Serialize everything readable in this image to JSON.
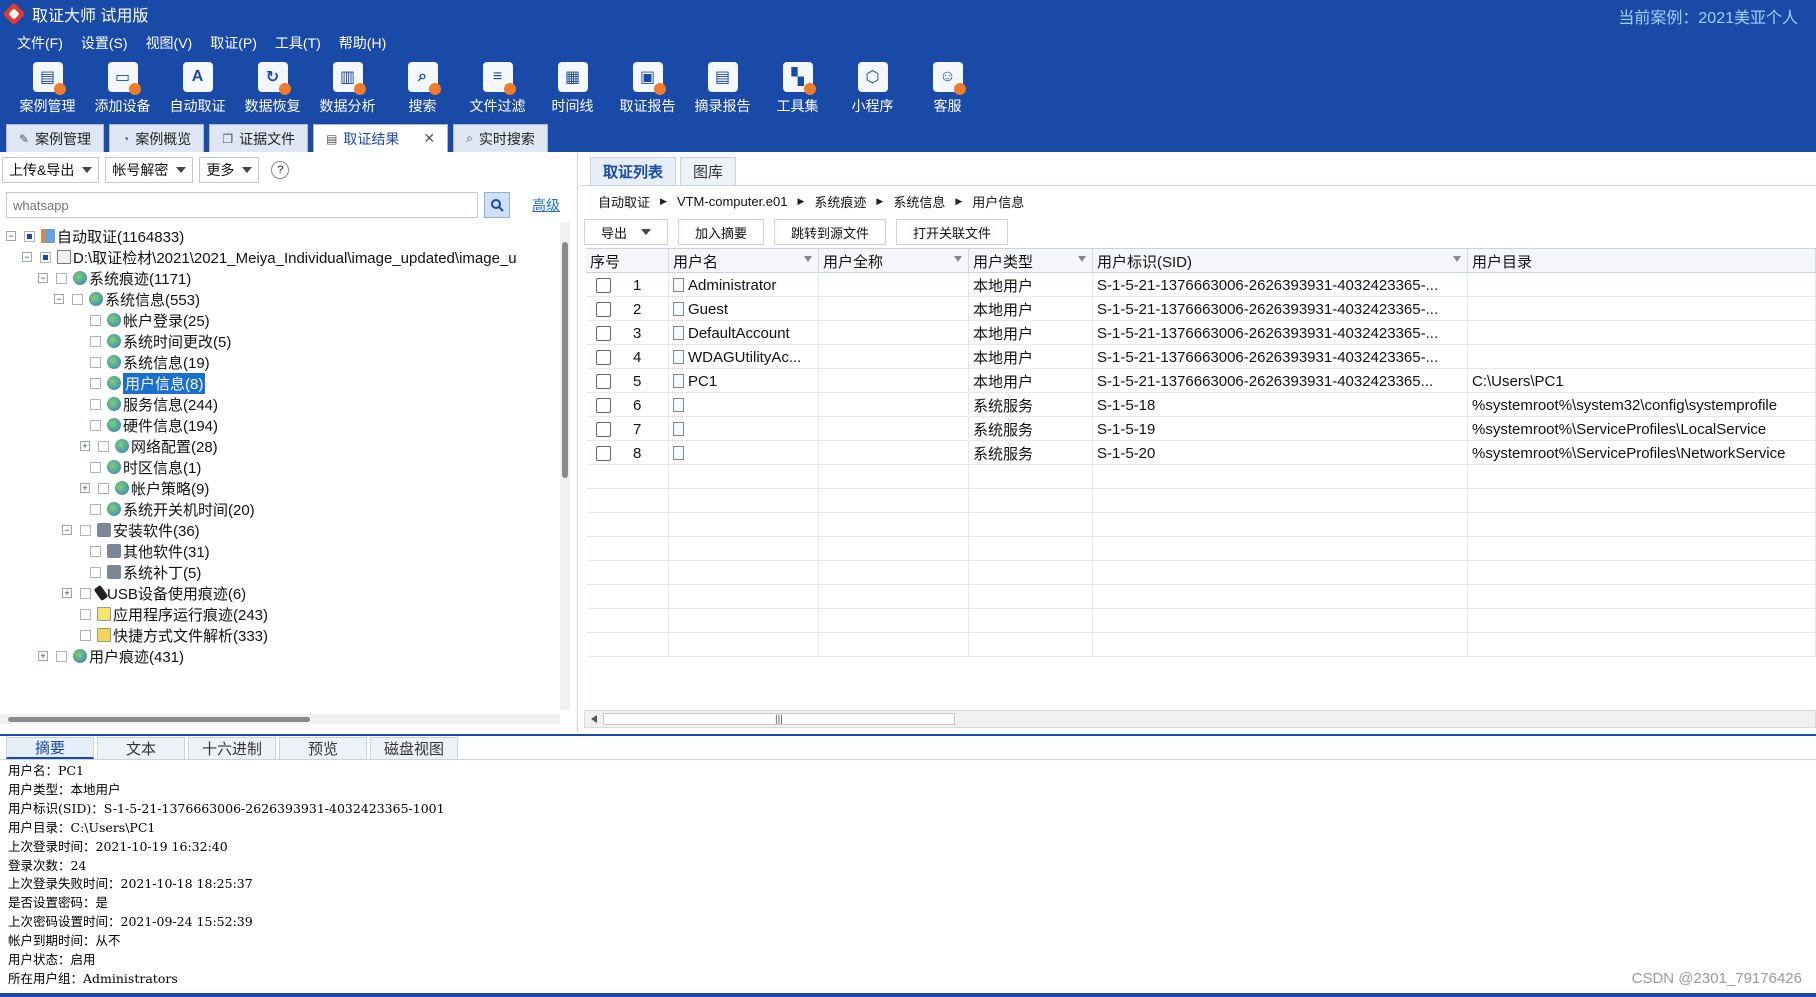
{
  "titlebar": {
    "app_title": "取证大师 试用版",
    "case_label": "当前案例：2021美亚个人"
  },
  "menu": [
    "文件(F)",
    "设置(S)",
    "视图(V)",
    "取证(P)",
    "工具(T)",
    "帮助(H)"
  ],
  "toolbar": [
    {
      "label": "案例管理",
      "icon": "case-icon"
    },
    {
      "label": "添加设备",
      "icon": "add-device-icon"
    },
    {
      "label": "自动取证",
      "icon": "auto-icon"
    },
    {
      "label": "数据恢复",
      "icon": "recover-icon"
    },
    {
      "label": "数据分析",
      "icon": "analysis-icon"
    },
    {
      "label": "搜索",
      "icon": "search-icon"
    },
    {
      "label": "文件过滤",
      "icon": "filter-icon"
    },
    {
      "label": "时间线",
      "icon": "timeline-icon"
    },
    {
      "label": "取证报告",
      "icon": "report-icon"
    },
    {
      "label": "摘录报告",
      "icon": "excerpt-icon"
    },
    {
      "label": "工具集",
      "icon": "tools-icon"
    },
    {
      "label": "小程序",
      "icon": "miniapp-icon"
    },
    {
      "label": "客服",
      "icon": "support-icon"
    }
  ],
  "top_tabs": [
    "案例管理",
    "案例概览",
    "证据文件",
    "取证结果",
    "实时搜索"
  ],
  "close_glyph": "✕",
  "left": {
    "upload_export": "上传&导出",
    "account_decrypt": "帐号解密",
    "more": "更多",
    "help": "?",
    "search_placeholder": "whatsapp",
    "advanced": "高级",
    "tree": [
      {
        "label": "自动取证(1164833)"
      },
      {
        "label": "D:\\取证检材\\2021\\2021_Meiya_Individual\\image_updated\\image_u"
      },
      {
        "label": "系统痕迹(1171)"
      },
      {
        "label": "系统信息(553)"
      },
      {
        "label": "帐户登录(25)"
      },
      {
        "label": "系统时间更改(5)"
      },
      {
        "label": "系统信息(19)"
      },
      {
        "label": "用户信息(8)"
      },
      {
        "label": "服务信息(244)"
      },
      {
        "label": "硬件信息(194)"
      },
      {
        "label": "网络配置(28)"
      },
      {
        "label": "时区信息(1)"
      },
      {
        "label": "帐户策略(9)"
      },
      {
        "label": "系统开关机时间(20)"
      },
      {
        "label": "安装软件(36)"
      },
      {
        "label": "其他软件(31)"
      },
      {
        "label": "系统补丁(5)"
      },
      {
        "label": "USB设备使用痕迹(6)"
      },
      {
        "label": "应用程序运行痕迹(243)"
      },
      {
        "label": "快捷方式文件解析(333)"
      },
      {
        "label": "用户痕迹(431)"
      }
    ]
  },
  "right": {
    "tabs": [
      "取证列表",
      "图库"
    ],
    "breadcrumb": [
      "自动取证",
      "VTM-computer.e01",
      "系统痕迹",
      "系统信息",
      "用户信息"
    ],
    "actions": [
      "导出",
      "加入摘要",
      "跳转到源文件",
      "打开关联文件"
    ],
    "columns": [
      "序号",
      "用户名",
      "用户全称",
      "用户类型",
      "用户标识(SID)",
      "用户目录"
    ],
    "rows": [
      {
        "no": "1",
        "name": "Administrator",
        "full": "",
        "type": "本地用户",
        "sid": "S-1-5-21-1376663006-2626393931-4032423365-...",
        "dir": ""
      },
      {
        "no": "2",
        "name": "Guest",
        "full": "",
        "type": "本地用户",
        "sid": "S-1-5-21-1376663006-2626393931-4032423365-...",
        "dir": ""
      },
      {
        "no": "3",
        "name": "DefaultAccount",
        "full": "",
        "type": "本地用户",
        "sid": "S-1-5-21-1376663006-2626393931-4032423365-...",
        "dir": ""
      },
      {
        "no": "4",
        "name": "WDAGUtilityAc...",
        "full": "",
        "type": "本地用户",
        "sid": "S-1-5-21-1376663006-2626393931-4032423365-...",
        "dir": ""
      },
      {
        "no": "5",
        "name": "PC1",
        "full": "",
        "type": "本地用户",
        "sid": "S-1-5-21-1376663006-2626393931-4032423365...",
        "dir": "C:\\Users\\PC1"
      },
      {
        "no": "6",
        "name": "",
        "full": "",
        "type": "系统服务",
        "sid": "S-1-5-18",
        "dir": "%systemroot%\\system32\\config\\systemprofile"
      },
      {
        "no": "7",
        "name": "",
        "full": "",
        "type": "系统服务",
        "sid": "S-1-5-19",
        "dir": "%systemroot%\\ServiceProfiles\\LocalService"
      },
      {
        "no": "8",
        "name": "",
        "full": "",
        "type": "系统服务",
        "sid": "S-1-5-20",
        "dir": "%systemroot%\\ServiceProfiles\\NetworkService"
      }
    ]
  },
  "bottom": {
    "tabs": [
      "摘要",
      "文本",
      "十六进制",
      "预览",
      "磁盘视图"
    ],
    "summary": [
      "用户名：PC1",
      "用户类型：本地用户",
      "用户标识(SID)：S-1-5-21-1376663006-2626393931-4032423365-1001",
      "用户目录：C:\\Users\\PC1",
      "上次登录时间：2021-10-19 16:32:40",
      "登录次数：24",
      "上次登录失败时间：2021-10-18 18:25:37",
      "是否设置密码：是",
      "上次密码设置时间：2021-09-24 15:52:39",
      "帐户到期时间：从不",
      "用户状态：启用",
      "所在用户组：Administrators"
    ]
  },
  "watermark": "CSDN @2301_79176426",
  "colors": {
    "chrome": "#1a4aa8",
    "selection": "#1a6fd0",
    "case_label": "#9fd0ff"
  }
}
